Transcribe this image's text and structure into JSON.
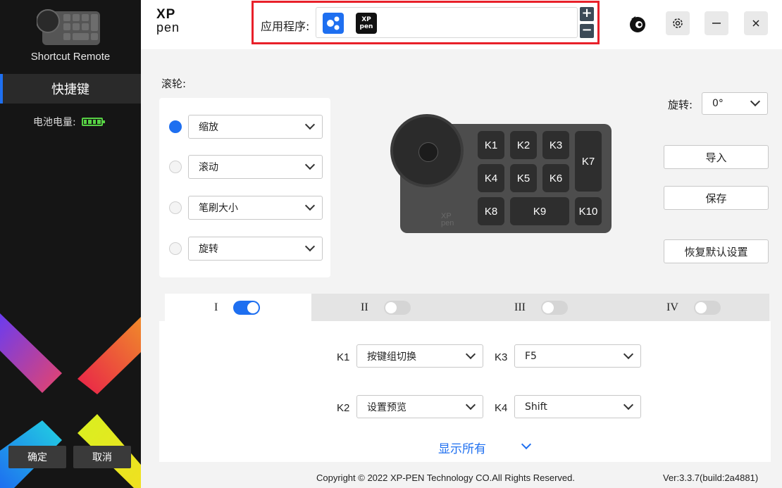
{
  "sidebar": {
    "device_name": "Shortcut Remote",
    "nav_item": "快捷键",
    "battery_label": "电池电量:",
    "confirm": "确定",
    "cancel": "取消"
  },
  "topbar": {
    "logo_line1": "XP",
    "logo_line2": "pen",
    "app_label": "应用程序:",
    "app_icon_2_line1": "XP",
    "app_icon_2_line2": "pen",
    "plus": "+",
    "minus": "−"
  },
  "wheel": {
    "title": "滚轮:",
    "options": [
      {
        "label": "缩放",
        "selected": true
      },
      {
        "label": "滚动",
        "selected": false
      },
      {
        "label": "笔刷大小",
        "selected": false
      },
      {
        "label": "旋转",
        "selected": false
      }
    ]
  },
  "device": {
    "keys": [
      "K1",
      "K2",
      "K3",
      "K4",
      "K5",
      "K6",
      "K7",
      "K8",
      "K9",
      "K10"
    ],
    "logo_line1": "XP",
    "logo_line2": "pen"
  },
  "right": {
    "rotation_label": "旋转:",
    "rotation_value": "0°",
    "import": "导入",
    "save": "保存",
    "reset": "恢复默认设置"
  },
  "tabs": [
    {
      "label": "I",
      "on": true
    },
    {
      "label": "II",
      "on": false
    },
    {
      "label": "III",
      "on": false
    },
    {
      "label": "IV",
      "on": false
    }
  ],
  "key_assignments": [
    {
      "key": "K1",
      "value": "按键组切换"
    },
    {
      "key": "K3",
      "value": "F5"
    },
    {
      "key": "K2",
      "value": "设置预览"
    },
    {
      "key": "K4",
      "value": "Shift"
    }
  ],
  "show_all": "显示所有",
  "footer": {
    "copyright": "Copyright © 2022  XP-PEN Technology CO.All Rights Reserved.",
    "version": "Ver:3.3.7(build:2a4881)"
  },
  "colors": {
    "accent": "#1e6ff0",
    "highlight_border": "#e8202a",
    "sidebar_bg": "#151515",
    "battery": "#57d244"
  }
}
